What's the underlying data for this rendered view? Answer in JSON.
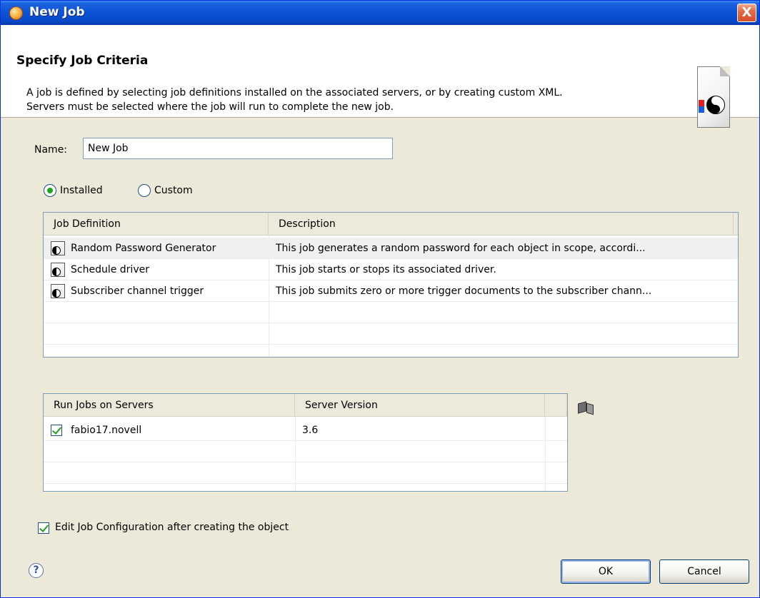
{
  "window": {
    "title": "New Job",
    "close_glyph": "X"
  },
  "header": {
    "title": "Specify Job Criteria",
    "description_line1": "A job is defined by selecting job definitions installed on the associated servers, or by creating custom XML.",
    "description_line2": "Servers must be selected where the job will run to complete the new job."
  },
  "form": {
    "name_label": "Name:",
    "name_value": "New Job",
    "radio_installed": "Installed",
    "radio_custom": "Custom",
    "selected_source": "Installed"
  },
  "job_table": {
    "columns": [
      "Job Definition",
      "Description"
    ],
    "rows": [
      {
        "name": "Random Password Generator",
        "description": "This job generates a random password for each object in scope, accordi..."
      },
      {
        "name": "Schedule driver",
        "description": "This job starts or stops its associated driver."
      },
      {
        "name": "Subscriber channel trigger",
        "description": "This job submits zero or more trigger documents to the subscriber chann..."
      }
    ]
  },
  "server_table": {
    "columns": [
      "Run Jobs on Servers",
      "Server Version"
    ],
    "rows": [
      {
        "checked": true,
        "server": "fabio17.novell",
        "version": "3.6"
      }
    ]
  },
  "options": {
    "edit_config_label": "Edit Job Configuration after creating the object",
    "edit_config_checked": true
  },
  "buttons": {
    "ok": "OK",
    "cancel": "Cancel",
    "help_glyph": "?"
  },
  "icons": {
    "title": "app-orb-icon",
    "header": "job-document-icon",
    "server_browse": "server-browse-icon",
    "help": "help-icon"
  },
  "colors": {
    "titlebar": "#0b52d6",
    "dialog_bg": "#ece9d8",
    "check_green": "#21a121",
    "close_red": "#d4502a"
  }
}
